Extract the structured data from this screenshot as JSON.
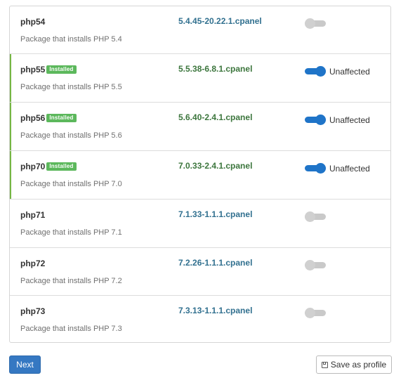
{
  "packages": [
    {
      "name": "php54",
      "installed": false,
      "description": "Package that installs PHP 5.4",
      "version": "5.4.45-20.22.1.cpanel",
      "enabled": false,
      "status": ""
    },
    {
      "name": "php55",
      "installed": true,
      "description": "Package that installs PHP 5.5",
      "version": "5.5.38-6.8.1.cpanel",
      "enabled": true,
      "status": "Unaffected"
    },
    {
      "name": "php56",
      "installed": true,
      "description": "Package that installs PHP 5.6",
      "version": "5.6.40-2.4.1.cpanel",
      "enabled": true,
      "status": "Unaffected"
    },
    {
      "name": "php70",
      "installed": true,
      "description": "Package that installs PHP 7.0",
      "version": "7.0.33-2.4.1.cpanel",
      "enabled": true,
      "status": "Unaffected"
    },
    {
      "name": "php71",
      "installed": false,
      "description": "Package that installs PHP 7.1",
      "version": "7.1.33-1.1.1.cpanel",
      "enabled": false,
      "status": ""
    },
    {
      "name": "php72",
      "installed": false,
      "description": "Package that installs PHP 7.2",
      "version": "7.2.26-1.1.1.cpanel",
      "enabled": false,
      "status": ""
    },
    {
      "name": "php73",
      "installed": false,
      "description": "Package that installs PHP 7.3",
      "version": "7.3.13-1.1.1.cpanel",
      "enabled": false,
      "status": ""
    }
  ],
  "badge_label": "Installed",
  "buttons": {
    "next_label": "Next",
    "save_label": "Save as profile",
    "save_icon": "floppy-disk-icon"
  },
  "colors": {
    "installed_accent": "#76b644",
    "badge_bg": "#5cb85c",
    "toggle_on": "#1f74c8",
    "toggle_off": "#c9c9c9",
    "version_default": "#31708f",
    "version_installed": "#3c763d",
    "primary_button": "#3578c2"
  }
}
